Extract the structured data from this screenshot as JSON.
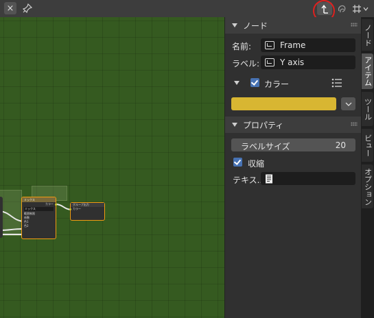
{
  "header": {
    "close_glyph": "×",
    "icons": [
      "close-icon",
      "pin-icon",
      "parent-node-tree-icon",
      "overlay-icon",
      "snap-grid-icon",
      "chevron-down-icon"
    ]
  },
  "canvas": {
    "background_color": "#355a20",
    "nodes": {
      "mix": {
        "title": "ミックス",
        "output": "カラー",
        "mode": "ミックス",
        "clamp": "範囲制限",
        "fac": "係数",
        "color1": "色1",
        "color2": "色2"
      },
      "group_output": {
        "title": "グループ出力",
        "input": "カラー"
      }
    }
  },
  "sidebar": {
    "node_panel": {
      "title": "ノード",
      "name_label": "名前:",
      "name_value": "Frame",
      "label_label": "ラベル:",
      "label_value": "Y axis",
      "color_label": "カラー",
      "color_checked": true,
      "color_value": "#d8b632"
    },
    "properties_panel": {
      "title": "プロパティ",
      "label_size_label": "ラベルサイズ",
      "label_size_value": "20",
      "shrink_label": "収縮",
      "shrink_checked": true,
      "text_label": "テキス...",
      "text_value": ""
    }
  },
  "tabs": [
    {
      "label": "ノード",
      "active": false
    },
    {
      "label": "アイテム",
      "active": true
    },
    {
      "label": "ツール",
      "active": false
    },
    {
      "label": "ビュー",
      "active": false
    },
    {
      "label": "オプション",
      "active": false
    }
  ],
  "annotation": {
    "highlight_color": "#e0201e"
  }
}
